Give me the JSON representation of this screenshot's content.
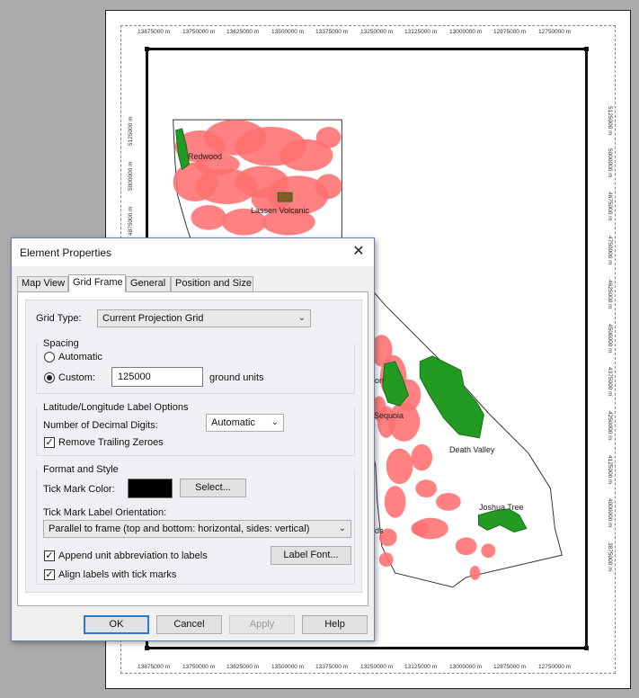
{
  "map": {
    "top_ticks": [
      "13875000 m",
      "13750000 m",
      "13625000 m",
      "13500000 m",
      "13375000 m",
      "13250000 m",
      "13125000 m",
      "13000000 m",
      "12875000 m",
      "12750000 m"
    ],
    "bottom_ticks": [
      "13875000 m",
      "13750000 m",
      "13625000 m",
      "13500000 m",
      "13375000 m",
      "13250000 m",
      "13125000 m",
      "13000000 m",
      "12875000 m",
      "12750000 m"
    ],
    "left_ticks": [
      "5125000 m",
      "5000000 m",
      "4875000 m"
    ],
    "right_ticks": [
      "5125000 m",
      "5000000 m",
      "4875000 m",
      "4750000 m",
      "4625000 m",
      "4500000 m",
      "4375000 m",
      "4250000 m",
      "4125000 m",
      "4000000 m",
      "3875000 m"
    ],
    "parks": {
      "redwood": "Redwood",
      "lassen": "Lassen Volcanic",
      "sequoia": "Sequoia",
      "sequoia_partial": "on",
      "death_valley": "Death Valley",
      "joshua_tree": "Joshua Tree",
      "partial_ds": "ds"
    },
    "colors": {
      "fire": "#ff7070",
      "park": "#239b23",
      "park_stroke": "#1a6e1a",
      "land_stroke": "#333333"
    }
  },
  "dialog": {
    "title": "Element Properties",
    "close_icon": "close-icon",
    "tabs": [
      {
        "label": "Map View",
        "active": false
      },
      {
        "label": "Grid Frame",
        "active": true
      },
      {
        "label": "General",
        "active": false
      },
      {
        "label": "Position and Size",
        "active": false
      }
    ],
    "grid_type": {
      "label": "Grid Type:",
      "value": "Current Projection Grid"
    },
    "spacing": {
      "heading": "Spacing",
      "automatic_label": "Automatic",
      "custom_label": "Custom:",
      "selected": "custom",
      "custom_value": "125000",
      "units": "ground units"
    },
    "latlon": {
      "heading": "Latitude/Longitude Label Options",
      "decimal_label": "Number of Decimal Digits:",
      "decimal_value": "Automatic",
      "remove_zeroes_label": "Remove Trailing Zeroes",
      "remove_zeroes_checked": true
    },
    "format": {
      "heading": "Format and Style",
      "tick_color_label": "Tick Mark Color:",
      "tick_color": "#000000",
      "select_button": "Select...",
      "orientation_label": "Tick Mark Label Orientation:",
      "orientation_value": "Parallel to frame (top and bottom: horizontal, sides: vertical)",
      "append_unit_label": "Append unit abbreviation to labels",
      "append_unit_checked": true,
      "align_labels_label": "Align labels with tick marks",
      "align_labels_checked": true,
      "label_font_button": "Label Font..."
    },
    "buttons": {
      "ok": "OK",
      "cancel": "Cancel",
      "apply": "Apply",
      "help": "Help"
    }
  }
}
